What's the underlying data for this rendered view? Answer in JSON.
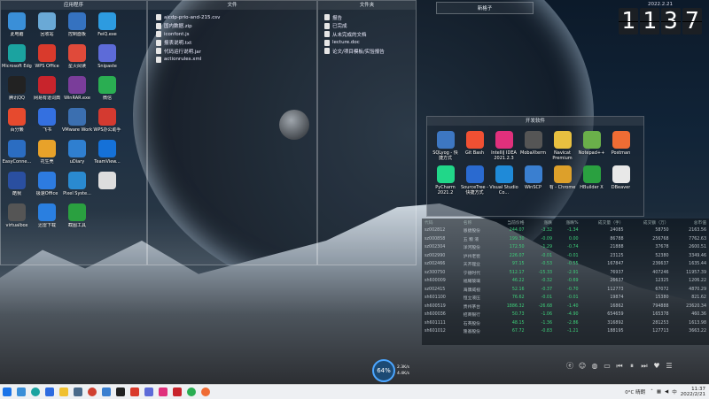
{
  "fences": {
    "apps_title": "应用程序",
    "files_title": "文件",
    "folders_title": "文件夹",
    "newbox_title": "新格子",
    "dev_title": "开发软件"
  },
  "desktop_icons": [
    {
      "label": "此电脑",
      "icon": "computer-icon",
      "color": "#3a8fd8"
    },
    {
      "label": "回收站",
      "icon": "recycle-bin-icon",
      "color": "#6aa9d6"
    },
    {
      "label": "控制面板",
      "icon": "control-panel-icon",
      "color": "#3572c0"
    },
    {
      "label": "FeiQ.exe",
      "icon": "feiq-icon",
      "color": "#2d9be0"
    },
    {
      "label": "Microsoft Edge",
      "icon": "edge-icon",
      "color": "#1ba3a0"
    },
    {
      "label": "WPS Office",
      "icon": "wps-icon",
      "color": "#d93a2c"
    },
    {
      "label": "星火阅读",
      "icon": "reader-icon",
      "color": "#e04a3a"
    },
    {
      "label": "Snipaste",
      "icon": "snipaste-icon",
      "color": "#5d6bd8"
    },
    {
      "label": "腾讯QQ",
      "icon": "qq-icon",
      "color": "#222"
    },
    {
      "label": "网易有道词典",
      "icon": "youdao-icon",
      "color": "#c8242c"
    },
    {
      "label": "WinRAR.exe",
      "icon": "winrar-icon",
      "color": "#7a3d9a"
    },
    {
      "label": "微信",
      "icon": "wechat-icon",
      "color": "#2aae52"
    },
    {
      "label": "百分懒",
      "icon": "baifen-icon",
      "color": "#e64a2e"
    },
    {
      "label": "飞书",
      "icon": "feishu-icon",
      "color": "#3470e0"
    },
    {
      "label": "VMware Workstati...",
      "icon": "vmware-icon",
      "color": "#3b6fb0"
    },
    {
      "label": "WPS办公助手",
      "icon": "wps-assistant-icon",
      "color": "#d43a30"
    },
    {
      "label": "EasyConne...",
      "icon": "easyconnect-icon",
      "color": "#2b6dc2"
    },
    {
      "label": "花生壳",
      "icon": "peanut-icon",
      "color": "#e8a22a"
    },
    {
      "label": "uDiary",
      "icon": "udiary-icon",
      "color": "#2f7fd0"
    },
    {
      "label": "TeamView...",
      "icon": "teamviewer-icon",
      "color": "#1571d8"
    },
    {
      "label": "酷我",
      "icon": "kuwo-icon",
      "color": "#2a4fa0"
    },
    {
      "label": "极速Office",
      "icon": "jisu-icon",
      "color": "#2d7be0"
    },
    {
      "label": "Pixel Syste...",
      "icon": "pixel-icon",
      "color": "#2a8ad0"
    },
    {
      "label": "",
      "icon": "blank-file-icon",
      "color": "#ddd"
    },
    {
      "label": "virtualbox",
      "icon": "virtualbox-icon",
      "color": "#555"
    },
    {
      "label": "迅雷下载",
      "icon": "xunlei-icon",
      "color": "#2a7fe0"
    },
    {
      "label": "截图工具",
      "icon": "snip-icon",
      "color": "#2aa040"
    }
  ],
  "files": [
    "aicdp-prio-and-215.csv",
    "国内数据.zip",
    "iconfont.js",
    "报表说明.txt",
    "代码运行说明.jar",
    "actionrules.xml"
  ],
  "folders": [
    "报告",
    "已完成",
    "从未完成的文档",
    "lecture.doc",
    "论文/项目模板/实验报告"
  ],
  "clock": {
    "date": "2022.2.21",
    "h1": "1",
    "h2": "1",
    "m1": "3",
    "m2": "7"
  },
  "dev_apps": [
    {
      "label": "SQLyog - 快捷方式",
      "icon": "sqlyog-icon",
      "color": "#3d77c2"
    },
    {
      "label": "Git Bash",
      "icon": "git-bash-icon",
      "color": "#f05033"
    },
    {
      "label": "IntelliJ IDEA 2021.2.3",
      "icon": "intellij-icon",
      "color": "#e0307c"
    },
    {
      "label": "MobaXterm",
      "icon": "mobaxterm-icon",
      "color": "#555"
    },
    {
      "label": "Navicat Premium",
      "icon": "navicat-icon",
      "color": "#e8c040"
    },
    {
      "label": "Notepad++",
      "icon": "notepadpp-icon",
      "color": "#6ab04a"
    },
    {
      "label": "Postman",
      "icon": "postman-icon",
      "color": "#ef6c34"
    },
    {
      "label": "PyCharm 2021.2",
      "icon": "pycharm-icon",
      "color": "#21d789"
    },
    {
      "label": "SourceTree - 快捷方式",
      "icon": "sourcetree-icon",
      "color": "#2a6ad0"
    },
    {
      "label": "Visual Studio Co...",
      "icon": "vscode-icon",
      "color": "#1f8ad8"
    },
    {
      "label": "WinSCP",
      "icon": "winscp-icon",
      "color": "#3a7fd0"
    },
    {
      "label": "有 - Chrome",
      "icon": "chrome-icon",
      "color": "#dda02a"
    },
    {
      "label": "HBuilder X",
      "icon": "hbuilder-icon",
      "color": "#2aa040"
    },
    {
      "label": "DBeaver",
      "icon": "dbeaver-icon",
      "color": "#e8e8e8"
    }
  ],
  "stock": {
    "headers": [
      "代码",
      "名称",
      "当前价格",
      "涨跌",
      "涨跌%",
      "成交量（手）",
      "成交额（万）",
      "总市值"
    ],
    "rows": [
      [
        "sz002812",
        "恩捷股份",
        "244.07",
        "-3.32",
        "-1.34",
        "24085",
        "58750",
        "2163.56",
        "green"
      ],
      [
        "sz000858",
        "五 粮 液",
        "199.30",
        "-0.09",
        "0.00",
        "86788",
        "256768",
        "7762.63",
        "green"
      ],
      [
        "sz002304",
        "洋河股份",
        "172.50",
        "-1.29",
        "-0.74",
        "21888",
        "37678",
        "2600.51",
        "green"
      ],
      [
        "sz002990",
        "泸州老窖",
        "226.07",
        "-0.01",
        "-0.01",
        "23125",
        "52380",
        "3349.46",
        "green"
      ],
      [
        "sz002466",
        "天齐锂业",
        "97.15",
        "-0.53",
        "-0.55",
        "167847",
        "236637",
        "1635.44",
        "green"
      ],
      [
        "sz300750",
        "宁德时代",
        "512.17",
        "-15.33",
        "-2.91",
        "76937",
        "407246",
        "11957.39",
        "green"
      ],
      [
        "sh600009",
        "福耀玻璃",
        "46.22",
        "-0.32",
        "-0.69",
        "26637",
        "12325",
        "1206.22",
        "green"
      ],
      [
        "sz002415",
        "海康威视",
        "52.16",
        "-0.37",
        "-0.70",
        "112773",
        "67072",
        "4870.29",
        "green"
      ],
      [
        "sh601100",
        "恒立液压",
        "76.62",
        "-0.01",
        "-0.01",
        "19874",
        "15380",
        "821.62",
        "green"
      ],
      [
        "sh600519",
        "贵州茅台",
        "1886.32",
        "-26.68",
        "-1.40",
        "16862",
        "794888",
        "23620.34",
        "green"
      ],
      [
        "sh600036",
        "招商银行",
        "50.73",
        "-1.06",
        "-4.90",
        "654659",
        "165378",
        "460.36",
        "green"
      ],
      [
        "sh601111",
        "石英股份",
        "48.15",
        "-1.36",
        "-2.86",
        "316892",
        "281253",
        "1613.98",
        "green"
      ],
      [
        "sh601012",
        "隆基股份",
        "67.72",
        "-0.83",
        "-1.21",
        "188195",
        "127713",
        "3663.22",
        "green"
      ]
    ]
  },
  "netmon": {
    "percent": "64%",
    "up": "2.3K/s",
    "down": "4.4K/s"
  },
  "tray": {
    "weather": "0°C 晴朗",
    "time": "11:37",
    "date": "2022/2/21"
  }
}
